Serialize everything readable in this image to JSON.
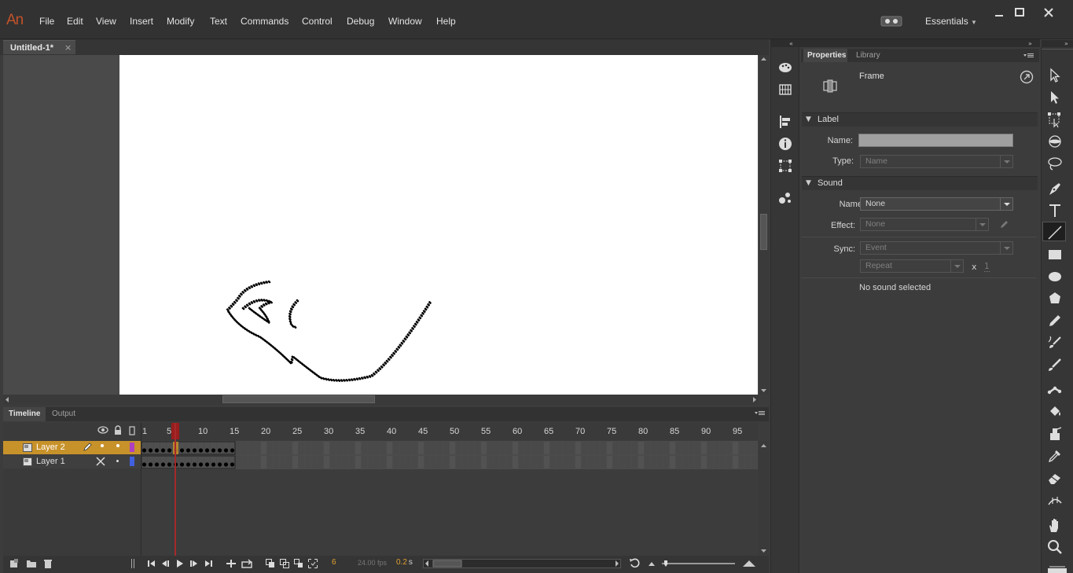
{
  "app": {
    "logo": "An"
  },
  "menu": [
    "File",
    "Edit",
    "View",
    "Insert",
    "Modify",
    "Text",
    "Commands",
    "Control",
    "Debug",
    "Window",
    "Help"
  ],
  "workspace": {
    "label": "Essentials"
  },
  "document": {
    "tab_title": "Untitled-1*",
    "close": "×"
  },
  "timeline": {
    "tabs": [
      "Timeline",
      "Output"
    ],
    "frame_numbers": [
      "1",
      "5",
      "10",
      "15",
      "20",
      "25",
      "30",
      "35",
      "40",
      "45",
      "50",
      "55",
      "60",
      "65",
      "70",
      "75",
      "80",
      "85",
      "90",
      "95"
    ],
    "layers": [
      {
        "name": "Layer 2",
        "selected": true,
        "color": "#b040c0",
        "frame_count": 15
      },
      {
        "name": "Layer 1",
        "selected": false,
        "color": "#4060e0",
        "frame_count": 15
      }
    ],
    "current_frame": "6",
    "fps": "24.00 fps",
    "time": "0.2",
    "time_unit": "s"
  },
  "properties": {
    "tabs": [
      "Properties",
      "Library"
    ],
    "object_type": "Frame",
    "label_section": {
      "title": "Label",
      "name_label": "Name:",
      "name_value": "",
      "type_label": "Type:",
      "type_value": "Name"
    },
    "sound_section": {
      "title": "Sound",
      "name_label": "Name:",
      "name_value": "None",
      "effect_label": "Effect:",
      "effect_value": "None",
      "sync_label": "Sync:",
      "sync_value": "Event",
      "repeat_value": "Repeat",
      "repeat_x": "x",
      "repeat_count": "1",
      "status": "No sound selected"
    }
  },
  "colors": {
    "accent": "#c8922a",
    "playhead": "#a52a2a",
    "logo": "#c2522a"
  },
  "dock_icons": [
    "color-icon",
    "swatches-icon",
    "align-icon",
    "info-icon",
    "transform-icon",
    "components-icon"
  ],
  "tools": [
    "selection-tool",
    "subselection-tool",
    "free-transform-tool",
    "3d-rotation-tool",
    "lasso-tool",
    "pen-tool",
    "text-tool",
    "line-tool",
    "rectangle-tool",
    "oval-tool",
    "polystar-tool",
    "pencil-tool",
    "brush-tool",
    "paint-brush-tool",
    "bone-tool",
    "paint-bucket-tool",
    "ink-bottle-tool",
    "eyedropper-tool",
    "eraser-tool",
    "width-tool",
    "hand-tool",
    "zoom-tool"
  ]
}
